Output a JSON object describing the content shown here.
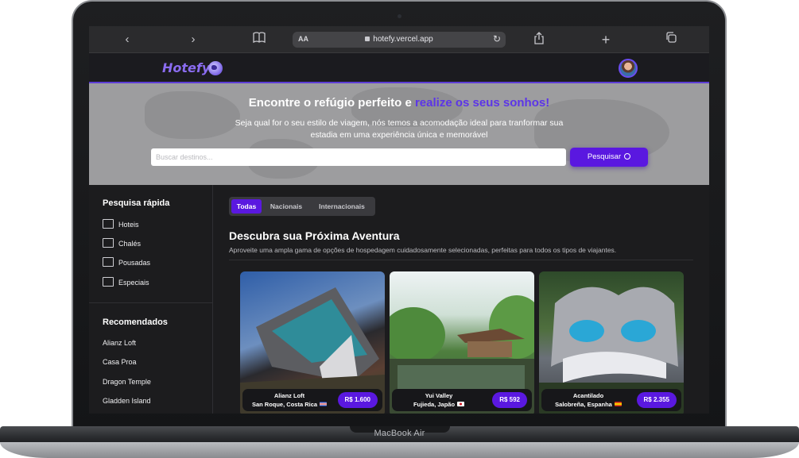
{
  "device": {
    "label": "MacBook Air"
  },
  "browser": {
    "text_size_label": "AA",
    "url": "hotefy.vercel.app"
  },
  "app": {
    "logo_text": "Hotefy"
  },
  "hero": {
    "title_start": "Encontre o refúgio perfeito e ",
    "title_accent": "realize os seus sonhos!",
    "subtitle": "Seja qual for o seu estilo de viagem, nós temos a acomodação ideal para tranformar sua estadia em uma experiência única e memorável",
    "search_placeholder": "Buscar destinos...",
    "search_button": "Pesquisar"
  },
  "sidebar": {
    "quick_search_title": "Pesquisa rápida",
    "quick_items": [
      {
        "label": "Hoteis",
        "icon": "hotel-icon"
      },
      {
        "label": "Chalés",
        "icon": "chalet-icon"
      },
      {
        "label": "Pousadas",
        "icon": "inn-icon"
      },
      {
        "label": "Especiais",
        "icon": "special-icon"
      }
    ],
    "recommended_title": "Recomendados",
    "recommended_items": [
      "Alianz Loft",
      "Casa Proa",
      "Dragon Temple",
      "Gladden Island"
    ]
  },
  "main": {
    "tabs": [
      "Todas",
      "Nacionais",
      "Internacionais"
    ],
    "active_tab": "Todas",
    "title": "Descubra sua Próxima Aventura",
    "description": "Aproveite uma ampla gama de opções de hospedagem cuidadosamente selecionadas, perfeitas para todos os tipos de viajantes.",
    "cards": [
      {
        "name": "Alianz Loft",
        "location": "San Roque, Costa Rica",
        "flag": "costa-rica-flag",
        "price": "R$ 1.600"
      },
      {
        "name": "Yui Valley",
        "location": "Fujieda, Japão",
        "flag": "japan-flag",
        "price": "R$ 592"
      },
      {
        "name": "Acantilado",
        "location": "Salobreña, Espanha",
        "flag": "spain-flag",
        "price": "R$ 2.355"
      }
    ]
  },
  "colors": {
    "accent": "#5a18e0",
    "logo": "#8a6cf0",
    "background": "#1c1c1e"
  }
}
